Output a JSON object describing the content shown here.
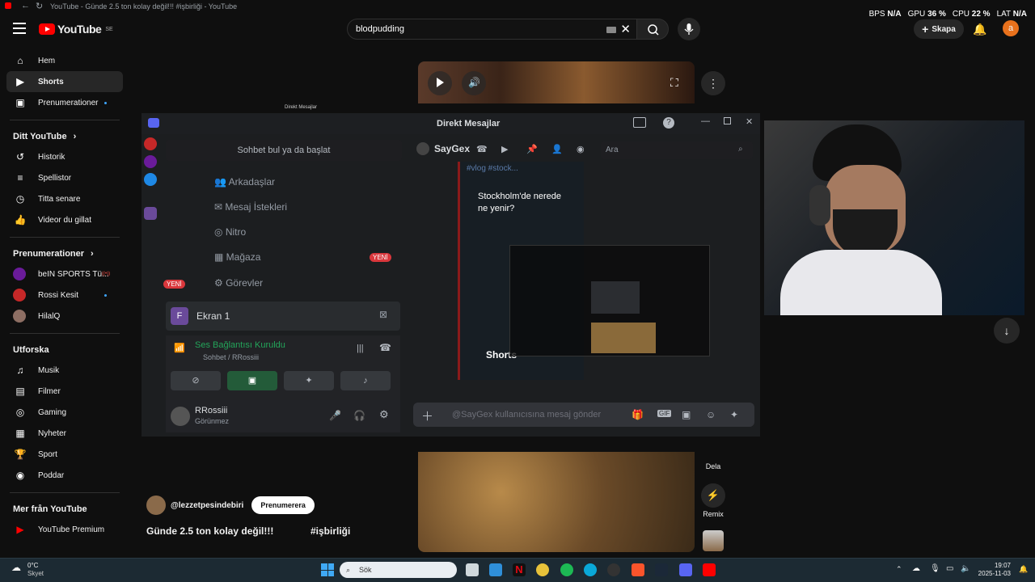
{
  "browser": {
    "tab_title": "YouTube - Günde 2.5 ton kolay değil!!! #işbirliği - YouTube"
  },
  "stats": {
    "bps_label": "BPS",
    "bps": "N/A",
    "gpu_label": "GPU",
    "gpu": "36 %",
    "cpu_label": "CPU",
    "cpu": "22 %",
    "lat_label": "LAT",
    "lat": "N/A"
  },
  "header": {
    "logo_text": "YouTube",
    "logo_region": "SE",
    "search_value": "blodpudding",
    "create_label": "Skapa",
    "avatar_letter": "a"
  },
  "sidebar": {
    "main": [
      {
        "label": "Hem",
        "icon": "⌂"
      },
      {
        "label": "Shorts",
        "icon": "▶"
      },
      {
        "label": "Prenumerationer",
        "icon": "▣"
      }
    ],
    "you_heading": "Ditt YouTube",
    "you_items": [
      {
        "label": "Historik",
        "icon": "↺"
      },
      {
        "label": "Spellistor",
        "icon": "≡"
      },
      {
        "label": "Titta senare",
        "icon": "◷"
      },
      {
        "label": "Videor du gillat",
        "icon": "👍"
      }
    ],
    "subs_heading": "Prenumerationer",
    "subs_items": [
      {
        "label": "beIN SPORTS Tü...",
        "color": "#6a1b9a"
      },
      {
        "label": "Rossi Kesit",
        "color": "#c62828"
      },
      {
        "label": "HilalQ",
        "color": "#8d6e63"
      }
    ],
    "explore_heading": "Utforska",
    "explore_items": [
      {
        "label": "Musik",
        "icon": "♫"
      },
      {
        "label": "Filmer",
        "icon": "▤"
      },
      {
        "label": "Gaming",
        "icon": "◎"
      },
      {
        "label": "Nyheter",
        "icon": "▦"
      },
      {
        "label": "Sport",
        "icon": "🏆"
      },
      {
        "label": "Poddar",
        "icon": "◉"
      }
    ],
    "more_heading": "Mer från YouTube",
    "more_items": [
      {
        "label": "YouTube Premium",
        "icon": "▶"
      }
    ]
  },
  "discord": {
    "window_title": "Direkt Mesajlar",
    "ghost_title": "Direkt Mesajlar",
    "search_label": "Sohbet bul ya da başlat",
    "friends": "Arkadaşlar",
    "requests": "Mesaj İstekleri",
    "nitro": "Nitro",
    "store": "Mağaza",
    "quests": "Görevler",
    "new_badge": "YENİ",
    "screen_label": "Ekran 1",
    "voice_status": "Ses Bağlantısı Kuruldu",
    "voice_channel": "Sohbet / RRossiii",
    "user_name": "RRossiii",
    "user_status": "Görünmez",
    "dm_user": "SayGex",
    "dm_search": "Ara",
    "message_placeholder": "@SayGex kullanıcısına mesaj gönder",
    "preview_text": "Stockholm'de nerede ne yenir?",
    "preview_tag": "#vlog #stock...",
    "shorts_label": "Shorts"
  },
  "video": {
    "channel": "@lezzetpesindebiri",
    "subscribe": "Prenumerera",
    "title": "Günde 2.5 ton kolay değil!!!",
    "tag": "#işbirliği",
    "share": "Dela",
    "remix": "Remix"
  },
  "taskbar": {
    "temp": "0°C",
    "weather": "Skyet",
    "search": "Sök",
    "time": "19:07",
    "date": "2025-11-03"
  }
}
